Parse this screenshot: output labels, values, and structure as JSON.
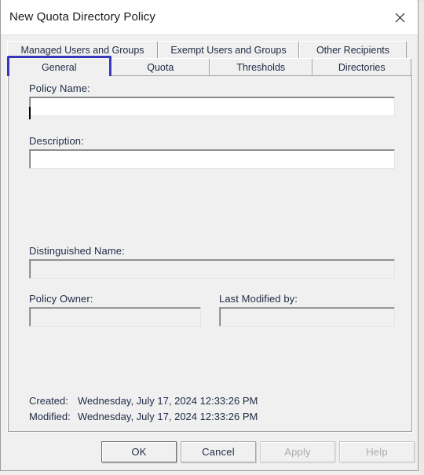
{
  "window": {
    "title": "New Quota Directory Policy",
    "close_icon": "close-icon"
  },
  "tabs": {
    "top_row": [
      {
        "label": "Managed Users and Groups",
        "selected": false
      },
      {
        "label": "Exempt Users and Groups",
        "selected": false
      },
      {
        "label": "Other Recipients",
        "selected": false
      }
    ],
    "bottom_row": [
      {
        "label": "General",
        "selected": true
      },
      {
        "label": "Quota",
        "selected": false
      },
      {
        "label": "Thresholds",
        "selected": false
      },
      {
        "label": "Directories",
        "selected": false
      }
    ]
  },
  "general": {
    "policy_name": {
      "label": "Policy Name:",
      "value": "",
      "placeholder": ""
    },
    "description": {
      "label": "Description:",
      "value": "",
      "placeholder": ""
    },
    "distinguished_name": {
      "label": "Distinguished Name:",
      "value": "",
      "readonly": true
    },
    "policy_owner": {
      "label": "Policy Owner:",
      "value": "",
      "readonly": true
    },
    "last_modified_by": {
      "label": "Last Modified by:",
      "value": "",
      "readonly": true
    },
    "created": {
      "label": "Created:",
      "value": "Wednesday, July 17, 2024 12:33:26  PM"
    },
    "modified": {
      "label": "Modified:",
      "value": "Wednesday, July 17, 2024 12:33:26  PM"
    }
  },
  "buttons": {
    "ok": {
      "label": "OK",
      "enabled": true,
      "default": true
    },
    "cancel": {
      "label": "Cancel",
      "enabled": true,
      "default": false
    },
    "apply": {
      "label": "Apply",
      "enabled": false,
      "default": false
    },
    "help": {
      "label": "Help",
      "enabled": false,
      "default": false
    }
  },
  "colors": {
    "focus_ring": "#3737bd",
    "dialog_face": "#f0f0f0",
    "titlebar": "#ffffff",
    "label_text": "#1f2a44",
    "disabled_text": "#acacac"
  }
}
